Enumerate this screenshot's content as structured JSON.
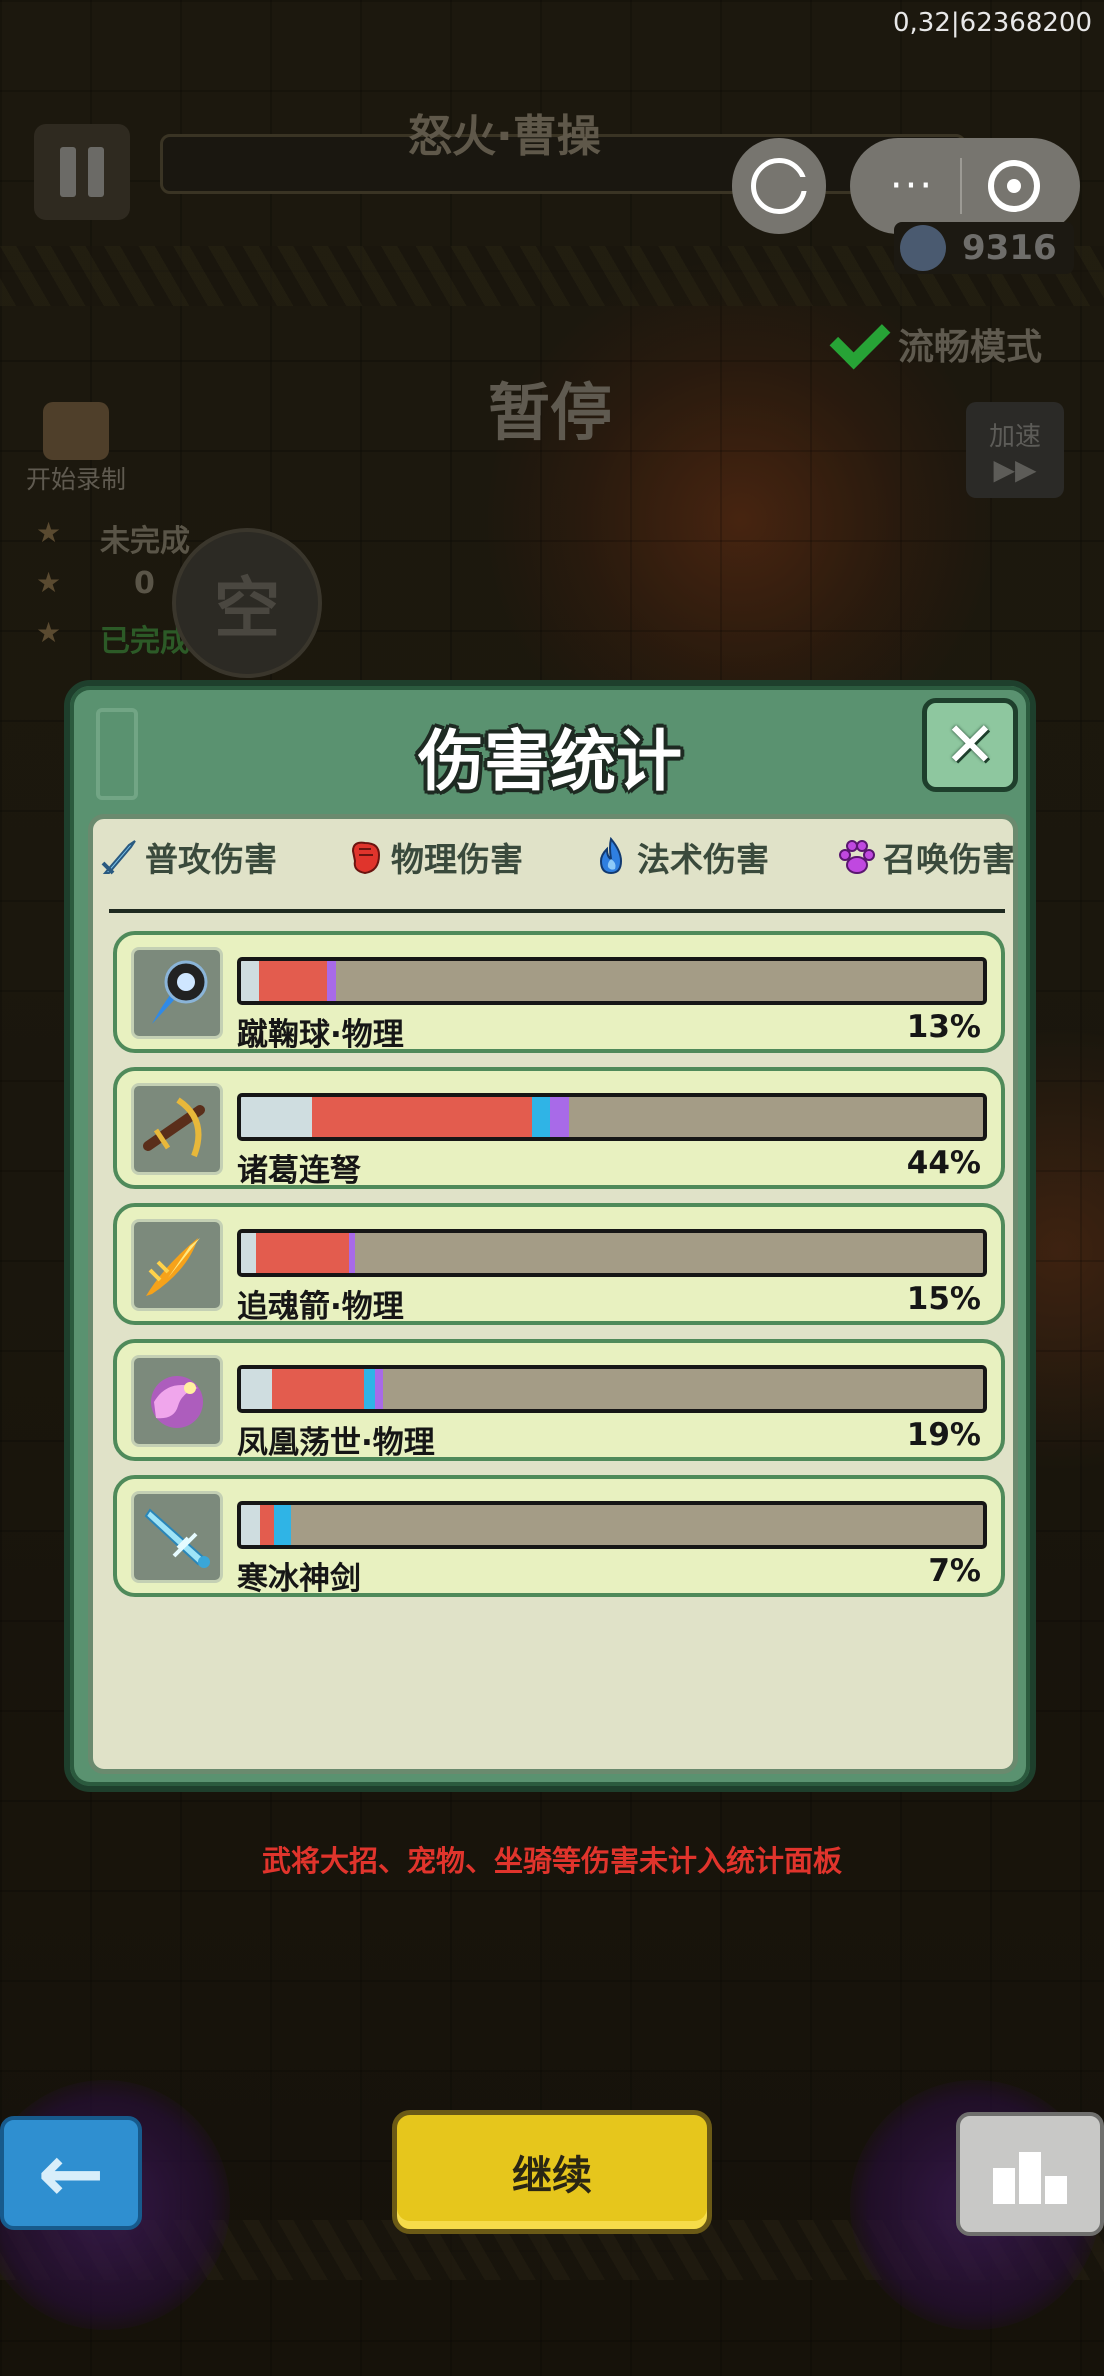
{
  "status": {
    "coord_text": "0,32|62368200"
  },
  "hud": {
    "boss_name": "怒火·曹操",
    "kill_count": "9316",
    "smooth_mode_label": "流畅模式",
    "paused_label": "暂停",
    "speed_label": "加速",
    "speed_arrow": "▶▶",
    "record_label": "开始录制",
    "task_incomplete": "未完成",
    "task_count": "0",
    "task_complete": "已完成",
    "empty_slot_label": "空"
  },
  "miniprogram": {
    "more_label": "···"
  },
  "modal": {
    "title": "伤害统计",
    "close_label": "✕",
    "legend": [
      {
        "label": "普攻伤害",
        "icon": "sword-icon",
        "color": "#7ec8f0"
      },
      {
        "label": "物理伤害",
        "icon": "fist-icon",
        "color": "#e0342c"
      },
      {
        "label": "法术伤害",
        "icon": "flame-icon",
        "color": "#2f7fe0"
      },
      {
        "label": "召唤伤害",
        "icon": "paw-icon",
        "color": "#c048e0"
      }
    ],
    "chart_data": {
      "type": "bar",
      "categories": [
        "蹴鞠球·物理",
        "诸葛连弩",
        "追魂箭·物理",
        "凤凰荡世·物理",
        "寒冰神剑"
      ],
      "percent_labels": [
        "13%",
        "44%",
        "15%",
        "19%",
        "7%"
      ],
      "values": [
        13,
        44,
        15,
        19,
        7
      ],
      "xlim": [
        0,
        100
      ],
      "segment_colors": [
        "#cfdde0",
        "#e35c4e",
        "#2fb4e6",
        "#a86ae8"
      ],
      "segments": [
        [
          2.4,
          9.2,
          0,
          1.2
        ],
        [
          9.6,
          29.6,
          2.4,
          2.6
        ],
        [
          2.0,
          12.6,
          0,
          0.8
        ],
        [
          4.2,
          12.4,
          1.4,
          1.2
        ],
        [
          2.6,
          1.8,
          2.4,
          0
        ]
      ],
      "icons": [
        "ball-icon",
        "crossbow-icon",
        "arrow-icon",
        "phoenix-icon",
        "ice-sword-icon"
      ]
    }
  },
  "footer_note": "武将大招、宠物、坐骑等伤害未计入统计面板",
  "buttons": {
    "back_label": "←",
    "continue_label": "继续"
  }
}
